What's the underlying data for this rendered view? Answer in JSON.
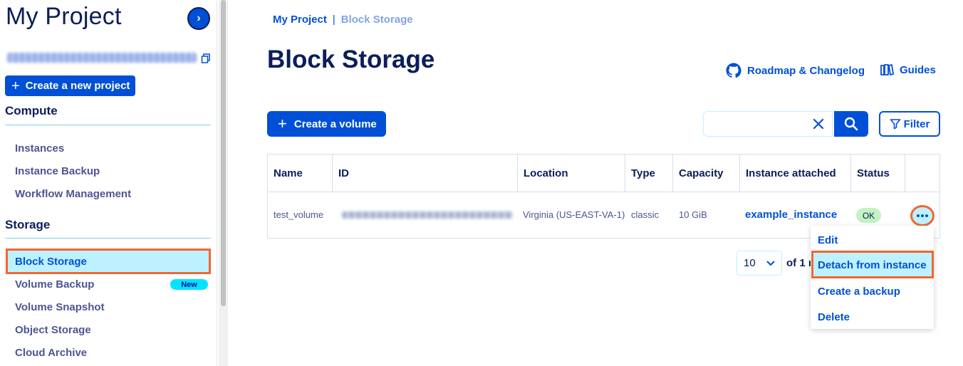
{
  "colors": {
    "primary": "#0050d7",
    "dark_navy": "#0b1e5b",
    "highlight_outline": "#f2662f",
    "active_bg": "#bef1ff",
    "new_badge": "#00e5ff",
    "ok_badge": "#c3f3c2"
  },
  "sidebar": {
    "title": "My Project",
    "toggle_icon": "chevron-right-icon",
    "copy_icon": "copy-icon",
    "create_project_label": "Create a new project",
    "sections": {
      "compute": "Compute",
      "storage": "Storage"
    },
    "compute_items": [
      "Instances",
      "Instance Backup",
      "Workflow Management"
    ],
    "storage_items": [
      "Block Storage",
      "Volume Backup",
      "Volume Snapshot",
      "Object Storage",
      "Cloud Archive"
    ],
    "new_badge": "New"
  },
  "breadcrumb": {
    "root": "My Project",
    "separator": "|",
    "current": "Block Storage"
  },
  "header": {
    "title": "Block Storage",
    "roadmap_label": "Roadmap & Changelog",
    "guides_label": "Guides"
  },
  "toolbar": {
    "create_volume_label": "Create a volume",
    "search_value": "",
    "filter_label": "Filter"
  },
  "table": {
    "columns": [
      "Name",
      "ID",
      "Location",
      "Type",
      "Capacity",
      "Instance attached",
      "Status"
    ],
    "rows": [
      {
        "name": "test_volume",
        "location": "Virginia (US-EAST-VA-1)",
        "type": "classic",
        "capacity": "10 GiB",
        "instance": "example_instance",
        "status": "OK"
      }
    ]
  },
  "pagination": {
    "page_size": "10",
    "text": "of 1 r"
  },
  "action_menu": {
    "items": [
      "Edit",
      "Detach from instance",
      "Create a backup",
      "Delete"
    ]
  }
}
